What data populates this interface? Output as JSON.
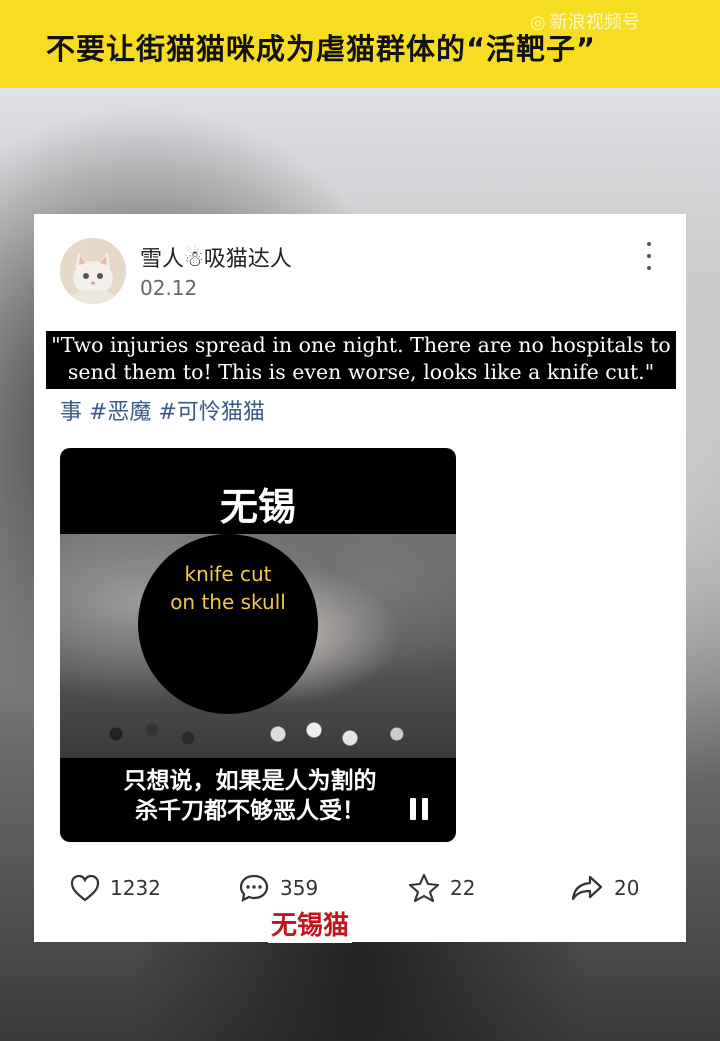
{
  "banner": {
    "title": "不要让街猫猫咪成为虐猫群体的“活靶子”",
    "watermark": "新浪视频号",
    "accent_color": "#f7dd22"
  },
  "post": {
    "username": "雪人☃吸猫达人",
    "date": "02.12",
    "caption_translation": "\"Two injuries spread in one night. There are no hospitals to send them to! This is even worse, looks like a knife cut.\"",
    "hashtags": "事 #恶魔 #可怜猫猫",
    "avatar_icon": "cat-avatar-icon",
    "more_icon": "more-vertical-icon"
  },
  "video": {
    "top_text": "无锡",
    "overlay_label_line1": "knife cut",
    "overlay_label_line2": "on the skull",
    "bottom_text_line1": "只想说，如果是人为割的",
    "bottom_text_line2": "杀千刀都不够恶人受！",
    "pause_icon": "pause-icon"
  },
  "actions": {
    "likes": "1232",
    "comments": "359",
    "favorites": "22",
    "shares": "20"
  },
  "tag_label": "无锡猫"
}
